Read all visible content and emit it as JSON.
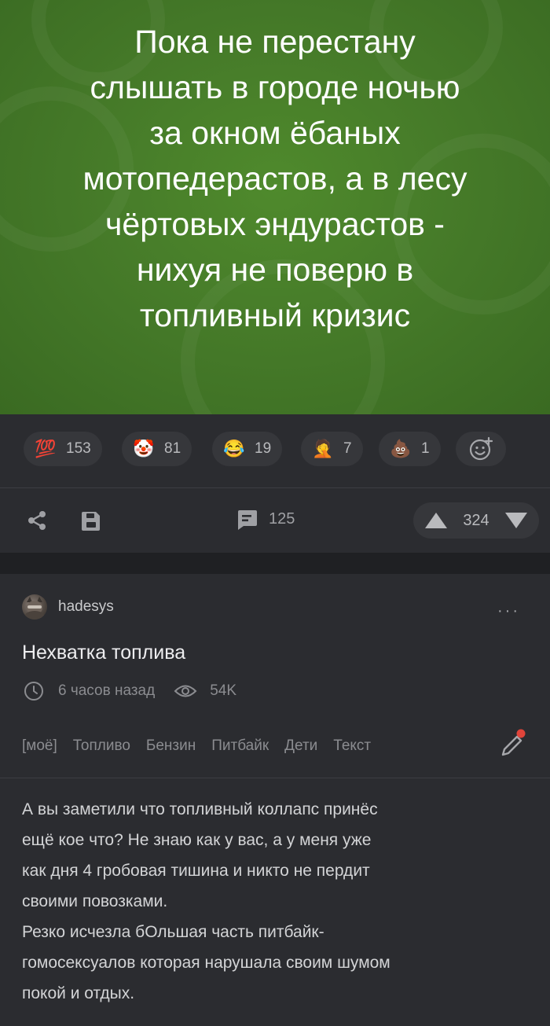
{
  "meme": {
    "text": "Пока не перестану\nслышать в городе ночью\nза окном ёбаных\nмотопедерастов, а в лесу\nчёртовых эндурастов -\nнихуя не поверю в\nтопливный кризис"
  },
  "reactions": [
    {
      "icon": "hundred-points-emoji",
      "glyph": "💯",
      "count": "153"
    },
    {
      "icon": "clown-face-emoji",
      "glyph": "🤡",
      "count": "81"
    },
    {
      "icon": "tears-of-joy-emoji",
      "glyph": "😂",
      "count": "19"
    },
    {
      "icon": "face-palm-emoji",
      "glyph": "🤦",
      "count": "7"
    },
    {
      "icon": "pile-of-poo-emoji",
      "glyph": "💩",
      "count": "1"
    }
  ],
  "actions": {
    "comments_count": "125",
    "rating": "324"
  },
  "post": {
    "author": "hadesys",
    "more": "···",
    "title": "Нехватка топлива",
    "time": "6 часов назад",
    "views": "54K",
    "tags": [
      "[моё]",
      "Топливо",
      "Бензин",
      "Питбайк",
      "Дети",
      "Текст"
    ],
    "body": "А вы заметили что топливный коллапс принёс\nещё кое что? Не знаю как у вас, а у меня уже\nкак дня 4 гробовая тишина и никто не пердит\nсвоими повозками.\nРезко исчезла бОльшая часть питбайк-\nгомосексуалов которая нарушала своим шумом\nпокой и отдых."
  },
  "colors": {
    "background": "#2b2c30",
    "meme_green": "#467b29",
    "chip": "#36373b",
    "accent_red": "#e0443a"
  }
}
